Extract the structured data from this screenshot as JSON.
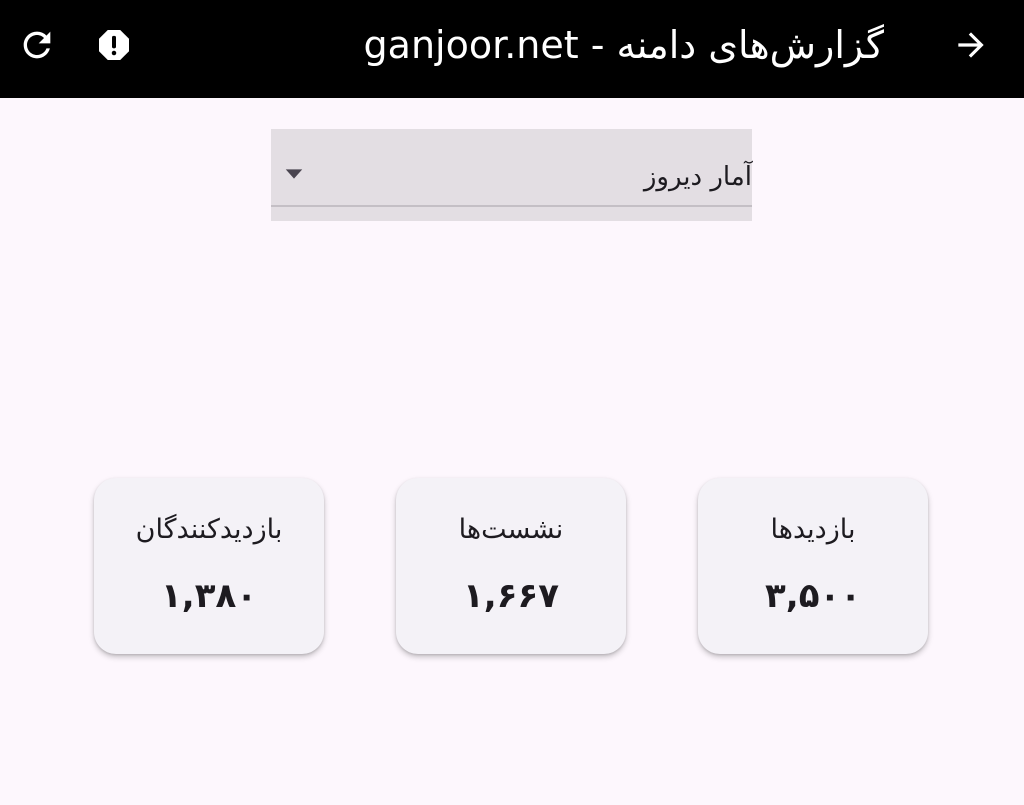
{
  "appbar": {
    "title": "گزارش‌های دامنه - ganjoor.net",
    "back_icon": "arrow-forward-icon",
    "report_icon": "report-icon",
    "refresh_icon": "refresh-icon"
  },
  "period_select": {
    "selected": "آمار دیروز"
  },
  "stats": [
    {
      "label": "بازدیدها",
      "value": "۳,۵۰۰"
    },
    {
      "label": "نشست‌ها",
      "value": "۱,۶۶۷"
    },
    {
      "label": "بازدیدکنندگان",
      "value": "۱,۳۸۰"
    }
  ],
  "colors": {
    "appbar_bg": "#000000",
    "page_bg": "#FDF7FD",
    "card_bg": "#F4F2F7",
    "dropdown_bg": "#E3DEE3",
    "text": "#1D1B20"
  }
}
